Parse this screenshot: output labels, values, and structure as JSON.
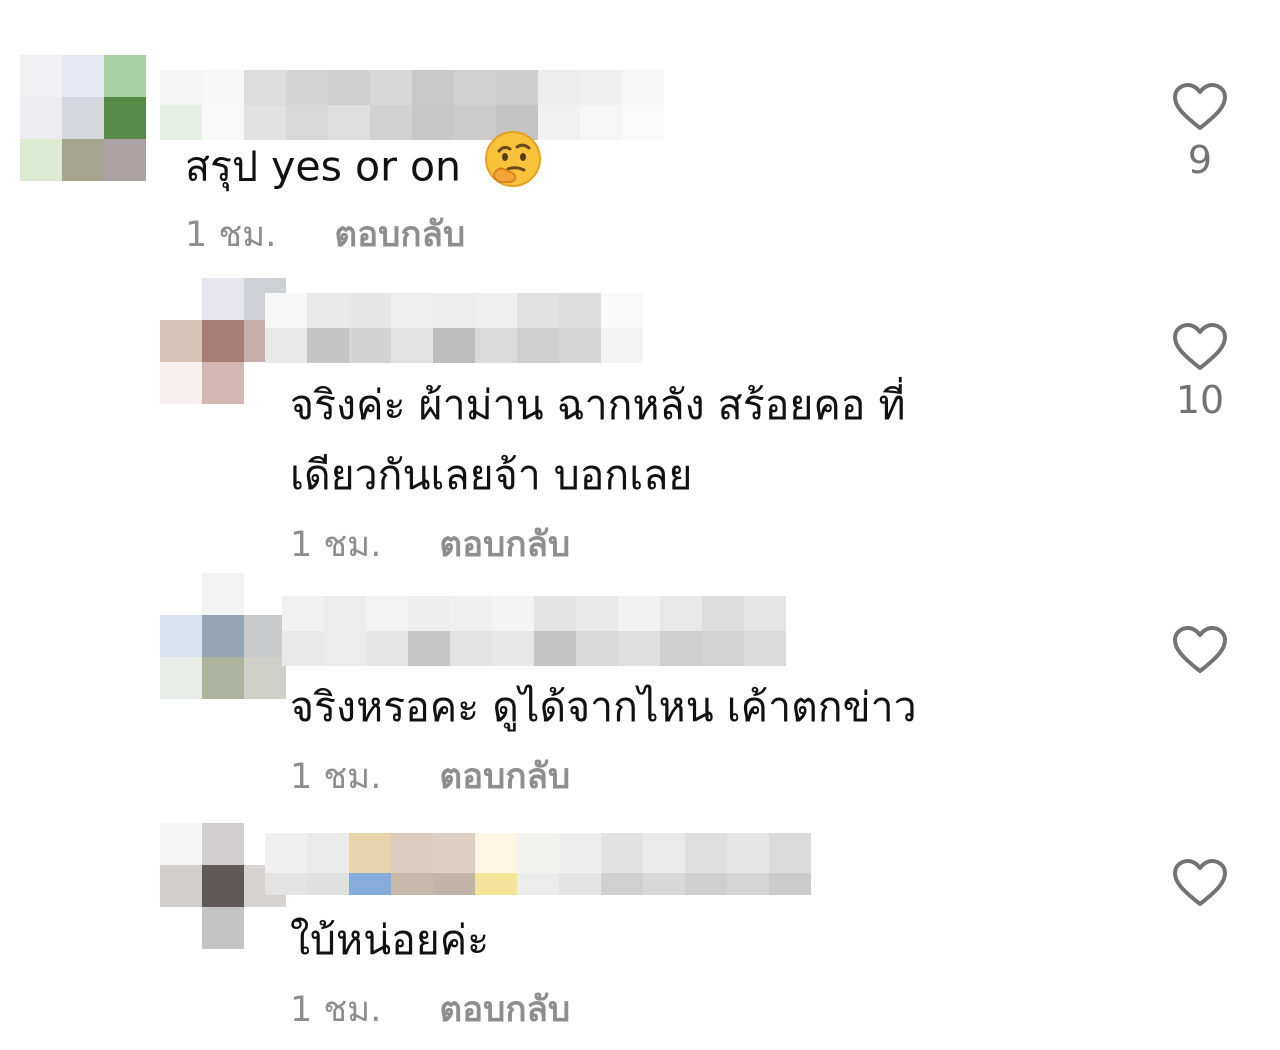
{
  "comments": [
    {
      "text": "สรุป yes or on",
      "emoji": "thinking-face",
      "time": "1 ชม.",
      "reply": "ตอบกลับ",
      "likes": "9",
      "avatar_colors": [
        "#f1f1f3",
        "#e6e9f2",
        "#a9cfa4",
        "#ececf0",
        "#d5d7df",
        "#568c48",
        "#dce9d3",
        "#a6a68e",
        "#aca1a3"
      ]
    },
    {
      "text_lines": [
        "จริงค่ะ ผ้าม่าน ฉากหลัง สร้อยคอ ที่",
        "เดียวกันเลยจ้า บอกเลย"
      ],
      "time": "1 ชม.",
      "reply": "ตอบกลับ",
      "likes": "10",
      "avatar_colors": [
        "#ffffff",
        "#e6e6ec",
        "#cfcfd6",
        "#d8c2b6",
        "#a67e73",
        "#c7adaa",
        "#f6f0f1",
        "#d4b7b3",
        "#ffffff"
      ]
    },
    {
      "text": "จริงหรอคะ ดูได้จากไหน เค้าตกข่าว",
      "time": "1 ชม.",
      "reply": "ตอบกลับ",
      "likes": "",
      "avatar_colors": [
        "#ffffff",
        "#f3f3f3",
        "#ffffff",
        "#d8e5f0",
        "#95a5b8",
        "#c8cacc",
        "#e9ebe6",
        "#aeb39d",
        "#cfcfc9"
      ]
    },
    {
      "text": "ใบ้หน่อยค่ะ",
      "time": "1 ชม.",
      "reply": "ตอบกลับ",
      "likes": "",
      "avatar_colors": [
        "#f5f5f5",
        "#cfcdcd",
        "#ffffff",
        "#d2cecb",
        "#5f5a57",
        "#d7d3d1",
        "#ffffff",
        "#c4c4c4",
        "#ffffff"
      ]
    }
  ],
  "colors": {
    "text": "#111111",
    "meta": "#8e8e8e",
    "heart": "#737373"
  }
}
